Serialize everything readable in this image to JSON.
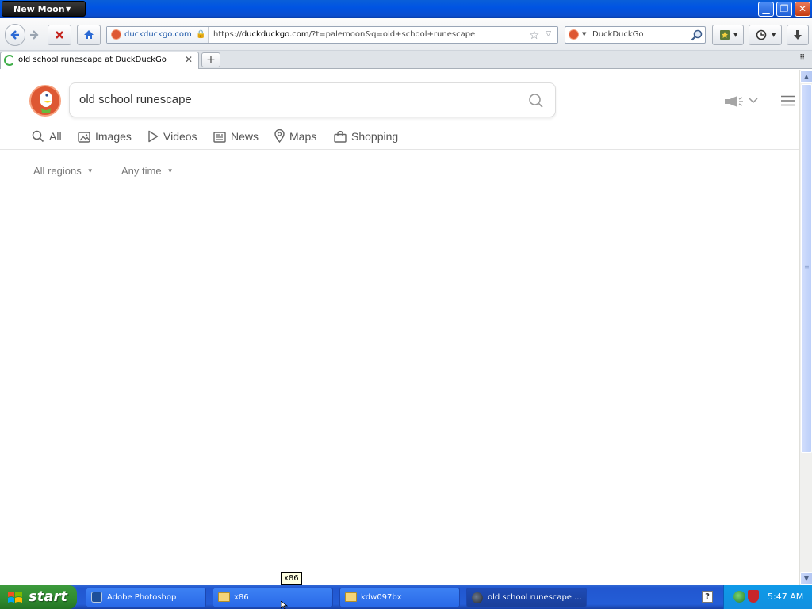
{
  "window": {
    "app_menu_label": "New Moon"
  },
  "navbar": {
    "site_identity": "duckduckgo.com",
    "url_prefix": "https://",
    "url_domain": "duckduckgo.com",
    "url_rest": "/?t=palemoon&q=old+school+runescape",
    "search_engine": "DuckDuckGo"
  },
  "tabs": [
    {
      "title": "old school runescape at DuckDuckGo"
    }
  ],
  "page": {
    "search_query": "old school runescape",
    "nav_tabs": [
      "All",
      "Images",
      "Videos",
      "News",
      "Maps",
      "Shopping"
    ],
    "filters": {
      "region": "All regions",
      "time": "Any time"
    }
  },
  "taskbar": {
    "start_label": "start",
    "tasks": [
      "Adobe Photoshop",
      "x86",
      "kdw097bx",
      "old school runescape ..."
    ],
    "tooltip": "x86",
    "clock": "5:47 AM"
  },
  "colors": {
    "ddg_orange": "#de5833",
    "xp_blue": "#0054e3",
    "start_green": "#2f8b2f"
  }
}
